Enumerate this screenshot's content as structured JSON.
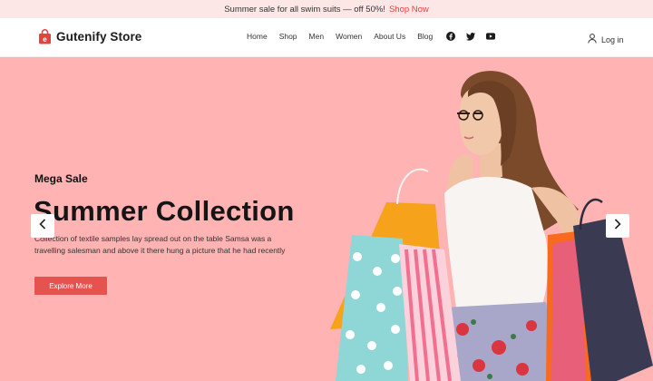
{
  "announcement": {
    "text": "Summer sale for all swim suits — off 50%!",
    "link": "Shop Now"
  },
  "header": {
    "brand": "Gutenify Store",
    "brand_icon": "shopping-bag-icon",
    "nav": [
      "Home",
      "Shop",
      "Men",
      "Women",
      "About Us",
      "Blog"
    ],
    "social": [
      "facebook-icon",
      "twitter-icon",
      "youtube-icon"
    ],
    "login": "Log in"
  },
  "hero": {
    "subtitle": "Mega Sale",
    "title": "Summer Collection",
    "description": "Collection of textile samples lay spread out on the table Samsa was a travelling salesman and above it there hung a picture that he had recently",
    "button": "Explore More",
    "background": "#ffb3b3"
  },
  "colors": {
    "accent": "#e4534d",
    "announce_bg": "#fde7e6"
  }
}
